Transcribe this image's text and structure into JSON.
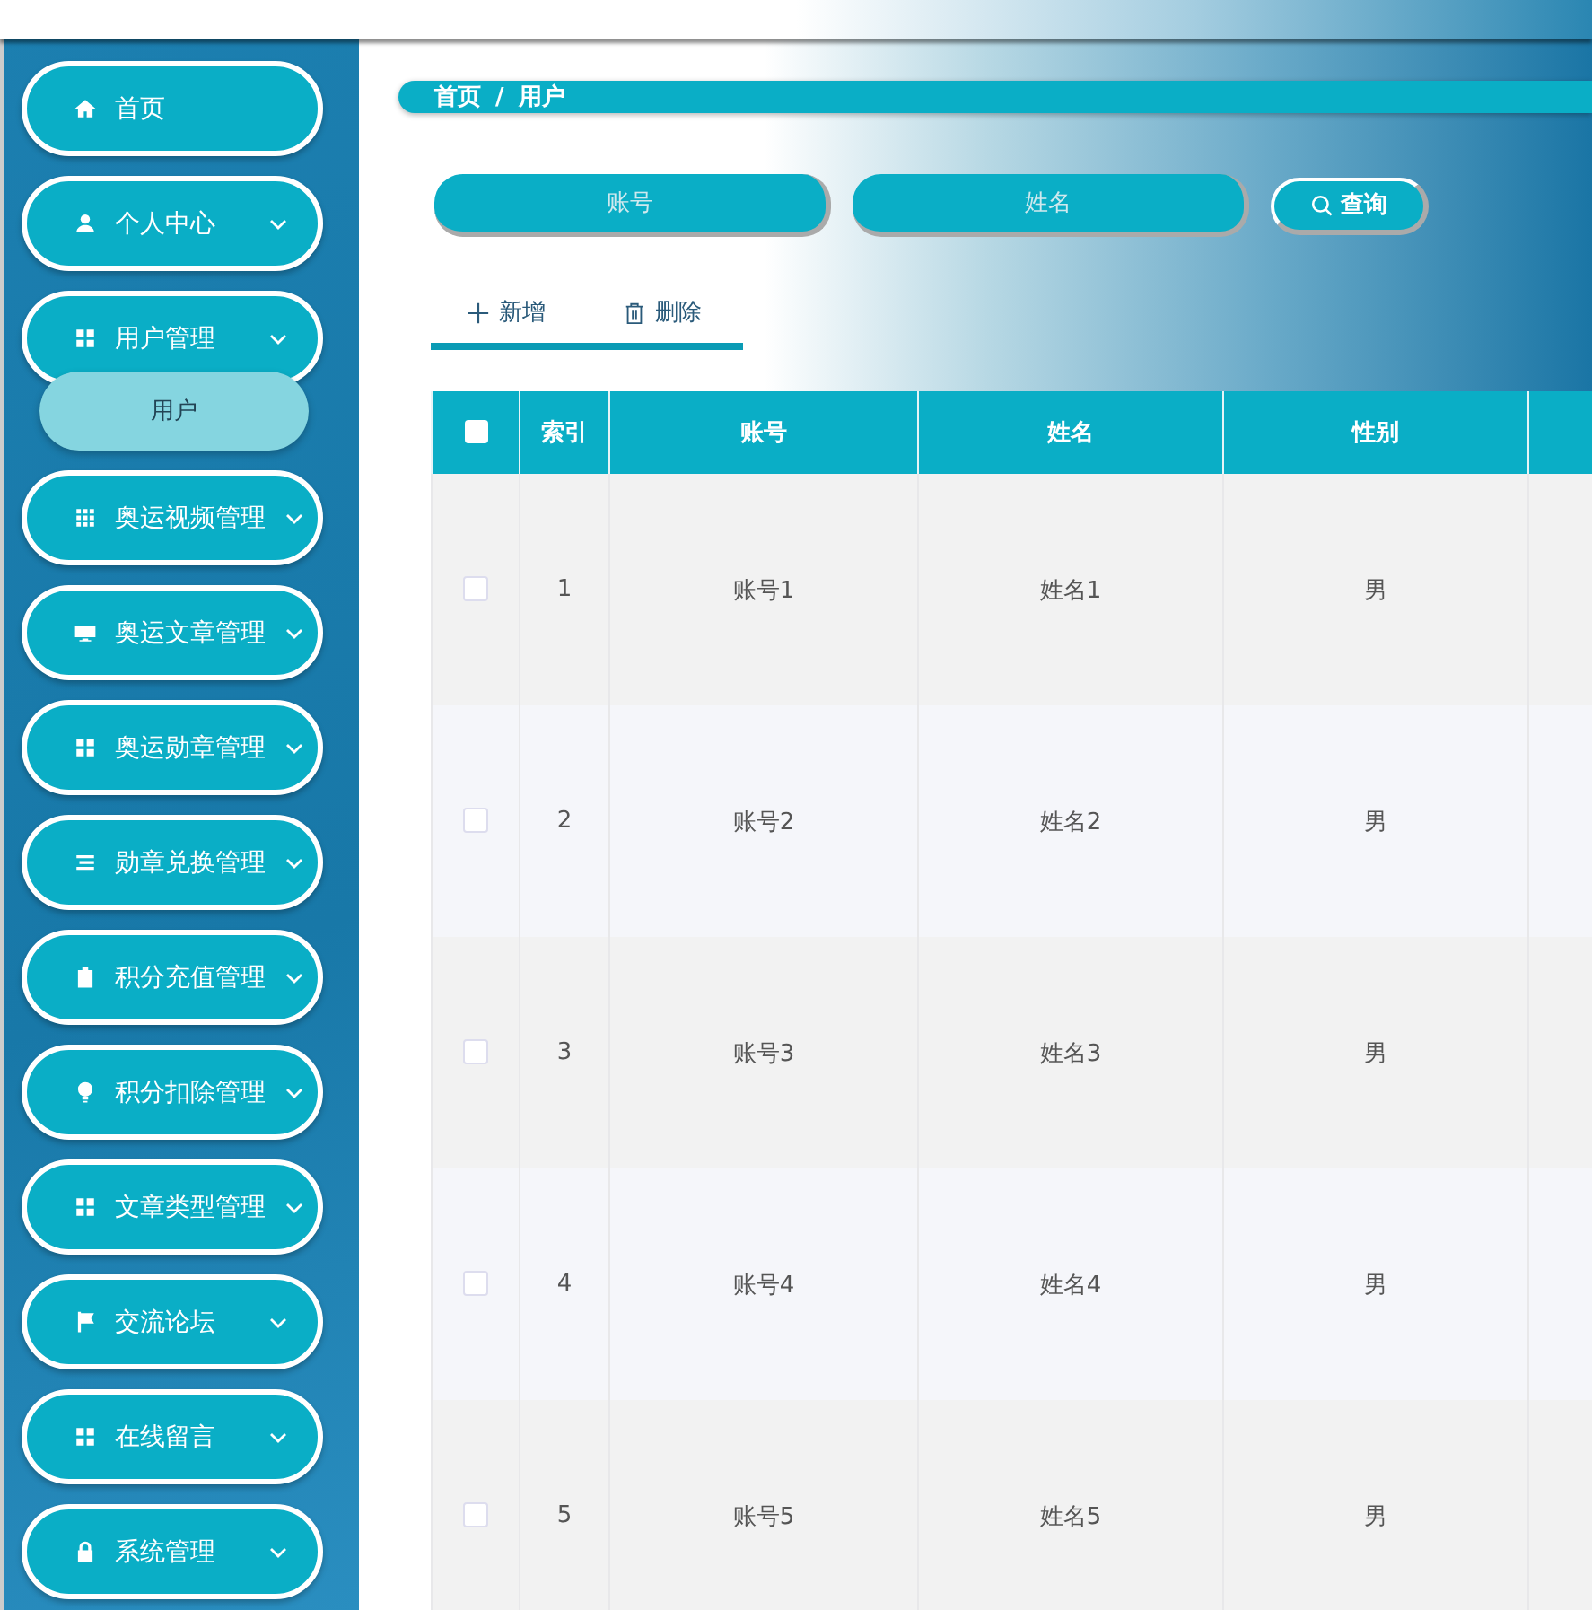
{
  "sidebar": {
    "items": [
      {
        "label": "首页",
        "expandable": false
      },
      {
        "label": "个人中心",
        "expandable": true
      },
      {
        "label": "用户管理",
        "expandable": true,
        "children": [
          {
            "label": "用户",
            "selected": true
          }
        ]
      },
      {
        "label": "奥运视频管理",
        "expandable": true
      },
      {
        "label": "奥运文章管理",
        "expandable": true
      },
      {
        "label": "奥运勋章管理",
        "expandable": true
      },
      {
        "label": "勋章兑换管理",
        "expandable": true
      },
      {
        "label": "积分充值管理",
        "expandable": true
      },
      {
        "label": "积分扣除管理",
        "expandable": true
      },
      {
        "label": "文章类型管理",
        "expandable": true
      },
      {
        "label": "交流论坛",
        "expandable": true
      },
      {
        "label": "在线留言",
        "expandable": true
      },
      {
        "label": "系统管理",
        "expandable": true
      }
    ]
  },
  "breadcrumb": {
    "items": [
      "首页",
      "用户"
    ],
    "separator": "/"
  },
  "search": {
    "fields": [
      {
        "placeholder": "账号"
      },
      {
        "placeholder": "姓名"
      }
    ],
    "button": "查询"
  },
  "toolbar": {
    "buttons": [
      "新增",
      "删除"
    ]
  },
  "table": {
    "all_checked": false,
    "columns": [
      "索引",
      "账号",
      "姓名",
      "性别"
    ],
    "rows": [
      {
        "checked": false,
        "index": "1",
        "account": "账号1",
        "name": "姓名1",
        "gender": "男"
      },
      {
        "checked": false,
        "index": "2",
        "account": "账号2",
        "name": "姓名2",
        "gender": "男"
      },
      {
        "checked": false,
        "index": "3",
        "account": "账号3",
        "name": "姓名3",
        "gender": "男"
      },
      {
        "checked": false,
        "index": "4",
        "account": "账号4",
        "name": "姓名4",
        "gender": "男"
      },
      {
        "checked": false,
        "index": "5",
        "account": "账号5",
        "name": "姓名5",
        "gender": "男"
      }
    ]
  }
}
